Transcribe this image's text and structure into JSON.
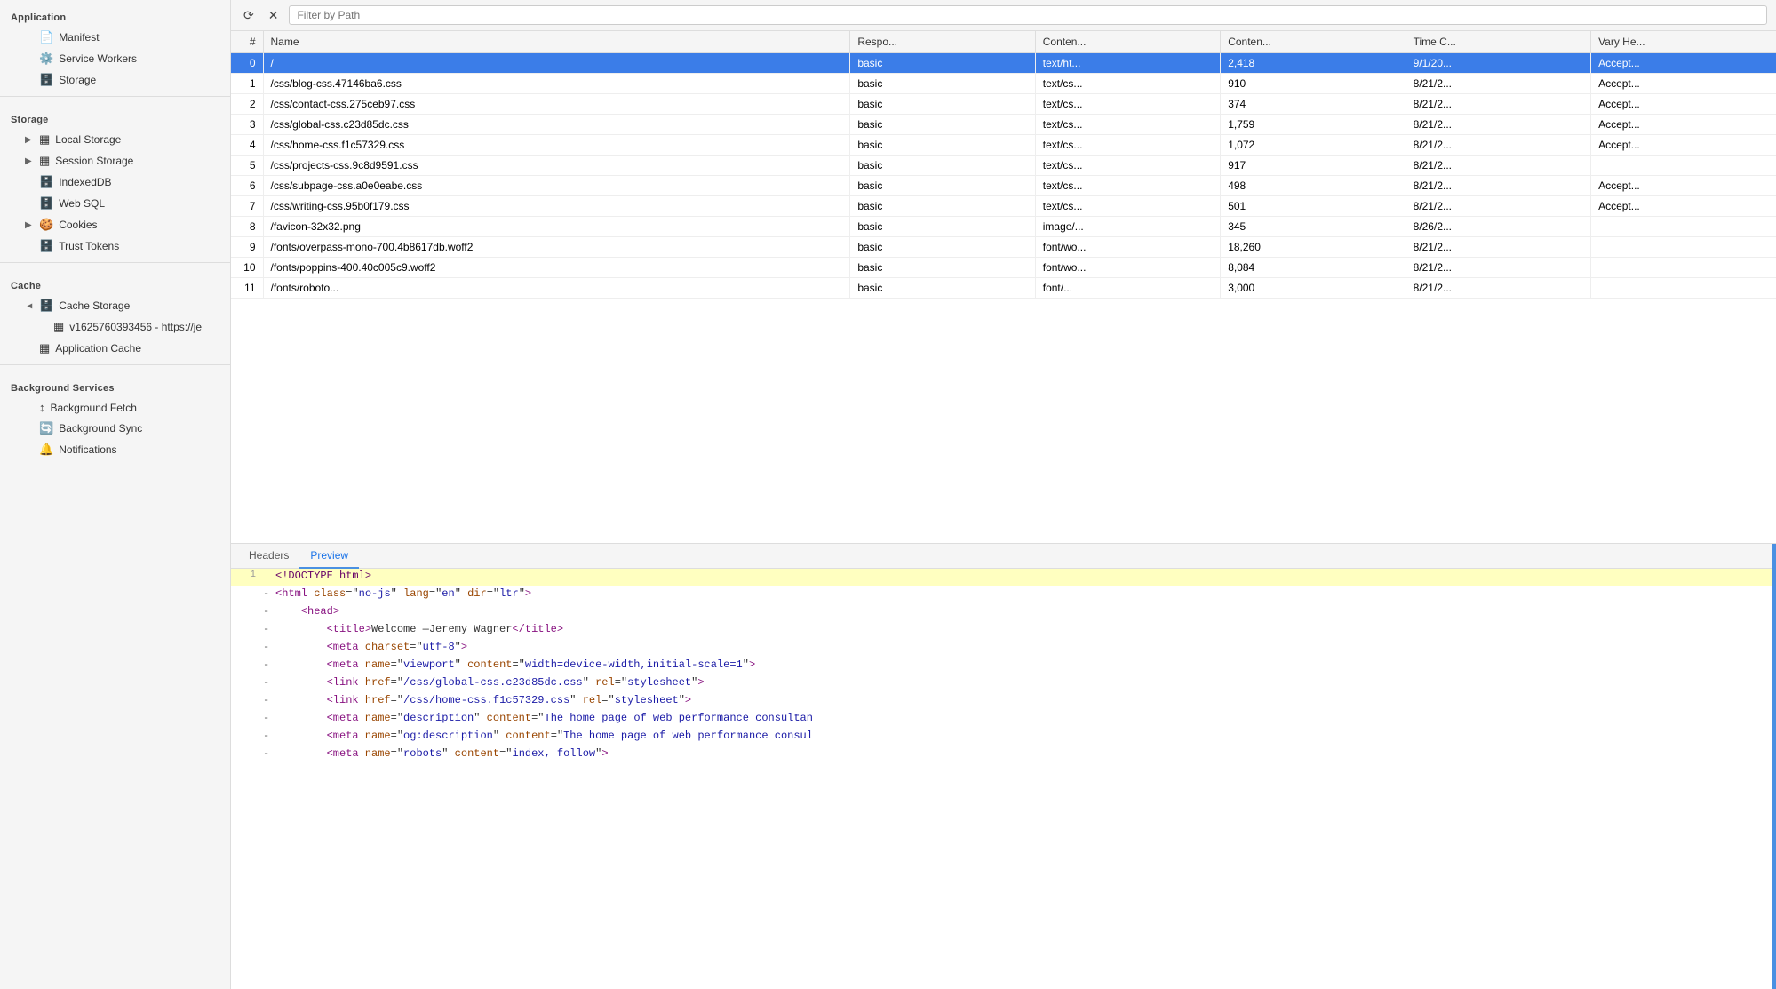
{
  "sidebar": {
    "sections": [
      {
        "label": "Application",
        "items": [
          {
            "id": "manifest",
            "label": "Manifest",
            "icon": "📄",
            "indent": 1,
            "arrow": false
          },
          {
            "id": "service-workers",
            "label": "Service Workers",
            "icon": "⚙️",
            "indent": 1,
            "arrow": false
          },
          {
            "id": "storage",
            "label": "Storage",
            "icon": "🗄️",
            "indent": 1,
            "arrow": false
          }
        ]
      },
      {
        "label": "Storage",
        "items": [
          {
            "id": "local-storage",
            "label": "Local Storage",
            "icon": "▦",
            "indent": 1,
            "arrow": true,
            "arrowOpen": false
          },
          {
            "id": "session-storage",
            "label": "Session Storage",
            "icon": "▦",
            "indent": 1,
            "arrow": true,
            "arrowOpen": false
          },
          {
            "id": "indexeddb",
            "label": "IndexedDB",
            "icon": "🗄️",
            "indent": 1,
            "arrow": false
          },
          {
            "id": "web-sql",
            "label": "Web SQL",
            "icon": "🗄️",
            "indent": 1,
            "arrow": false
          },
          {
            "id": "cookies",
            "label": "Cookies",
            "icon": "🍪",
            "indent": 1,
            "arrow": true,
            "arrowOpen": false
          },
          {
            "id": "trust-tokens",
            "label": "Trust Tokens",
            "icon": "🗄️",
            "indent": 1,
            "arrow": false
          }
        ]
      },
      {
        "label": "Cache",
        "items": [
          {
            "id": "cache-storage",
            "label": "Cache Storage",
            "icon": "🗄️",
            "indent": 1,
            "arrow": true,
            "arrowOpen": true
          },
          {
            "id": "cache-entry",
            "label": "v1625760393456 - https://je",
            "icon": "▦",
            "indent": 2,
            "arrow": false
          },
          {
            "id": "app-cache",
            "label": "Application Cache",
            "icon": "▦",
            "indent": 1,
            "arrow": false
          }
        ]
      },
      {
        "label": "Background Services",
        "items": [
          {
            "id": "bg-fetch",
            "label": "Background Fetch",
            "icon": "↕",
            "indent": 1,
            "arrow": false
          },
          {
            "id": "bg-sync",
            "label": "Background Sync",
            "icon": "🔄",
            "indent": 1,
            "arrow": false
          },
          {
            "id": "notifications",
            "label": "Notifications",
            "icon": "🔔",
            "indent": 1,
            "arrow": false
          }
        ]
      }
    ]
  },
  "toolbar": {
    "refresh_title": "Refresh",
    "clear_title": "Clear",
    "filter_placeholder": "Filter by Path"
  },
  "table": {
    "columns": [
      "#",
      "Name",
      "Respo...",
      "Conten...",
      "Conten...",
      "Time C...",
      "Vary He..."
    ],
    "rows": [
      {
        "num": "0",
        "name": "/",
        "resp": "basic",
        "ctype": "text/ht...",
        "clen": "2,418",
        "time": "9/1/20...",
        "vary": "Accept...",
        "selected": true
      },
      {
        "num": "1",
        "name": "/css/blog-css.47146ba6.css",
        "resp": "basic",
        "ctype": "text/cs...",
        "clen": "910",
        "time": "8/21/2...",
        "vary": "Accept...",
        "selected": false
      },
      {
        "num": "2",
        "name": "/css/contact-css.275ceb97.css",
        "resp": "basic",
        "ctype": "text/cs...",
        "clen": "374",
        "time": "8/21/2...",
        "vary": "Accept...",
        "selected": false
      },
      {
        "num": "3",
        "name": "/css/global-css.c23d85dc.css",
        "resp": "basic",
        "ctype": "text/cs...",
        "clen": "1,759",
        "time": "8/21/2...",
        "vary": "Accept...",
        "selected": false
      },
      {
        "num": "4",
        "name": "/css/home-css.f1c57329.css",
        "resp": "basic",
        "ctype": "text/cs...",
        "clen": "1,072",
        "time": "8/21/2...",
        "vary": "Accept...",
        "selected": false
      },
      {
        "num": "5",
        "name": "/css/projects-css.9c8d9591.css",
        "resp": "basic",
        "ctype": "text/cs...",
        "clen": "917",
        "time": "8/21/2...",
        "vary": "",
        "selected": false
      },
      {
        "num": "6",
        "name": "/css/subpage-css.a0e0eabe.css",
        "resp": "basic",
        "ctype": "text/cs...",
        "clen": "498",
        "time": "8/21/2...",
        "vary": "Accept...",
        "selected": false
      },
      {
        "num": "7",
        "name": "/css/writing-css.95b0f179.css",
        "resp": "basic",
        "ctype": "text/cs...",
        "clen": "501",
        "time": "8/21/2...",
        "vary": "Accept...",
        "selected": false
      },
      {
        "num": "8",
        "name": "/favicon-32x32.png",
        "resp": "basic",
        "ctype": "image/...",
        "clen": "345",
        "time": "8/26/2...",
        "vary": "",
        "selected": false
      },
      {
        "num": "9",
        "name": "/fonts/overpass-mono-700.4b8617db.woff2",
        "resp": "basic",
        "ctype": "font/wo...",
        "clen": "18,260",
        "time": "8/21/2...",
        "vary": "",
        "selected": false
      },
      {
        "num": "10",
        "name": "/fonts/poppins-400.40c005c9.woff2",
        "resp": "basic",
        "ctype": "font/wo...",
        "clen": "8,084",
        "time": "8/21/2...",
        "vary": "",
        "selected": false
      },
      {
        "num": "11",
        "name": "/fonts/roboto...",
        "resp": "basic",
        "ctype": "font/...",
        "clen": "3,000",
        "time": "8/21/2...",
        "vary": "",
        "selected": false
      }
    ]
  },
  "detail": {
    "tabs": [
      {
        "id": "headers",
        "label": "Headers",
        "active": false
      },
      {
        "id": "preview",
        "label": "Preview",
        "active": true
      }
    ],
    "code_lines": [
      {
        "num": "1",
        "marker": " ",
        "content": "<!DOCTYPE html>",
        "highlighted": true,
        "parts": [
          {
            "cls": "c-doctype",
            "text": "<!DOCTYPE html>"
          }
        ]
      },
      {
        "num": "",
        "marker": "-",
        "content": "<html class=\"no-js\" lang=\"en\" dir=\"ltr\">",
        "highlighted": false,
        "parts": [
          {
            "cls": "c-tag",
            "text": "<html"
          },
          {
            "cls": "c-text",
            "text": " "
          },
          {
            "cls": "c-attr",
            "text": "class"
          },
          {
            "cls": "c-text",
            "text": "=\""
          },
          {
            "cls": "c-val",
            "text": "no-js"
          },
          {
            "cls": "c-text",
            "text": "\" "
          },
          {
            "cls": "c-attr",
            "text": "lang"
          },
          {
            "cls": "c-text",
            "text": "=\""
          },
          {
            "cls": "c-val",
            "text": "en"
          },
          {
            "cls": "c-text",
            "text": "\" "
          },
          {
            "cls": "c-attr",
            "text": "dir"
          },
          {
            "cls": "c-text",
            "text": "=\""
          },
          {
            "cls": "c-val",
            "text": "ltr"
          },
          {
            "cls": "c-text",
            "text": "\""
          },
          {
            "cls": "c-tag",
            "text": ">"
          }
        ]
      },
      {
        "num": "",
        "marker": "-",
        "content": "    <head>",
        "highlighted": false,
        "parts": [
          {
            "cls": "c-text",
            "text": "    "
          },
          {
            "cls": "c-tag",
            "text": "<head>"
          }
        ]
      },
      {
        "num": "",
        "marker": "-",
        "content": "        <title>Welcome &mdash;Jeremy Wagner</title>",
        "highlighted": false,
        "parts": [
          {
            "cls": "c-text",
            "text": "        "
          },
          {
            "cls": "c-tag",
            "text": "<title>"
          },
          {
            "cls": "c-text",
            "text": "Welcome —Jeremy Wagner"
          },
          {
            "cls": "c-tag",
            "text": "</title>"
          }
        ]
      },
      {
        "num": "",
        "marker": "-",
        "content": "        <meta charset=\"utf-8\">",
        "highlighted": false,
        "parts": [
          {
            "cls": "c-text",
            "text": "        "
          },
          {
            "cls": "c-tag",
            "text": "<meta"
          },
          {
            "cls": "c-text",
            "text": " "
          },
          {
            "cls": "c-attr",
            "text": "charset"
          },
          {
            "cls": "c-text",
            "text": "=\""
          },
          {
            "cls": "c-val",
            "text": "utf-8"
          },
          {
            "cls": "c-text",
            "text": "\""
          },
          {
            "cls": "c-tag",
            "text": ">"
          }
        ]
      },
      {
        "num": "",
        "marker": "-",
        "content": "        <meta name=\"viewport\" content=\"width=device-width,initial-scale=1\">",
        "highlighted": false,
        "parts": [
          {
            "cls": "c-text",
            "text": "        "
          },
          {
            "cls": "c-tag",
            "text": "<meta"
          },
          {
            "cls": "c-text",
            "text": " "
          },
          {
            "cls": "c-attr",
            "text": "name"
          },
          {
            "cls": "c-text",
            "text": "=\""
          },
          {
            "cls": "c-val",
            "text": "viewport"
          },
          {
            "cls": "c-text",
            "text": "\" "
          },
          {
            "cls": "c-attr",
            "text": "content"
          },
          {
            "cls": "c-text",
            "text": "=\""
          },
          {
            "cls": "c-val",
            "text": "width=device-width,initial-scale=1"
          },
          {
            "cls": "c-text",
            "text": "\""
          },
          {
            "cls": "c-tag",
            "text": ">"
          }
        ]
      },
      {
        "num": "",
        "marker": "-",
        "content": "        <link href=\"/css/global-css.c23d85dc.css\" rel=\"stylesheet\">",
        "highlighted": false,
        "parts": [
          {
            "cls": "c-text",
            "text": "        "
          },
          {
            "cls": "c-tag",
            "text": "<link"
          },
          {
            "cls": "c-text",
            "text": " "
          },
          {
            "cls": "c-attr",
            "text": "href"
          },
          {
            "cls": "c-text",
            "text": "=\""
          },
          {
            "cls": "c-val",
            "text": "/css/global-css.c23d85dc.css"
          },
          {
            "cls": "c-text",
            "text": "\" "
          },
          {
            "cls": "c-attr",
            "text": "rel"
          },
          {
            "cls": "c-text",
            "text": "=\""
          },
          {
            "cls": "c-val",
            "text": "stylesheet"
          },
          {
            "cls": "c-text",
            "text": "\""
          },
          {
            "cls": "c-tag",
            "text": ">"
          }
        ]
      },
      {
        "num": "",
        "marker": "-",
        "content": "        <link href=\"/css/home-css.f1c57329.css\" rel=\"stylesheet\">",
        "highlighted": false,
        "parts": [
          {
            "cls": "c-text",
            "text": "        "
          },
          {
            "cls": "c-tag",
            "text": "<link"
          },
          {
            "cls": "c-text",
            "text": " "
          },
          {
            "cls": "c-attr",
            "text": "href"
          },
          {
            "cls": "c-text",
            "text": "=\""
          },
          {
            "cls": "c-val",
            "text": "/css/home-css.f1c57329.css"
          },
          {
            "cls": "c-text",
            "text": "\" "
          },
          {
            "cls": "c-attr",
            "text": "rel"
          },
          {
            "cls": "c-text",
            "text": "=\""
          },
          {
            "cls": "c-val",
            "text": "stylesheet"
          },
          {
            "cls": "c-text",
            "text": "\""
          },
          {
            "cls": "c-tag",
            "text": ">"
          }
        ]
      },
      {
        "num": "",
        "marker": "-",
        "content": "        <meta name=\"description\" content=\"The home page of web performance consultan",
        "highlighted": false,
        "parts": [
          {
            "cls": "c-text",
            "text": "        "
          },
          {
            "cls": "c-tag",
            "text": "<meta"
          },
          {
            "cls": "c-text",
            "text": " "
          },
          {
            "cls": "c-attr",
            "text": "name"
          },
          {
            "cls": "c-text",
            "text": "=\""
          },
          {
            "cls": "c-val",
            "text": "description"
          },
          {
            "cls": "c-text",
            "text": "\" "
          },
          {
            "cls": "c-attr",
            "text": "content"
          },
          {
            "cls": "c-text",
            "text": "=\""
          },
          {
            "cls": "c-val",
            "text": "The home page of web performance consultan"
          }
        ]
      },
      {
        "num": "",
        "marker": "-",
        "content": "        <meta name=\"og:description\" content=\"The home page of web performance consul",
        "highlighted": false,
        "parts": [
          {
            "cls": "c-text",
            "text": "        "
          },
          {
            "cls": "c-tag",
            "text": "<meta"
          },
          {
            "cls": "c-text",
            "text": " "
          },
          {
            "cls": "c-attr",
            "text": "name"
          },
          {
            "cls": "c-text",
            "text": "=\""
          },
          {
            "cls": "c-val",
            "text": "og:description"
          },
          {
            "cls": "c-text",
            "text": "\" "
          },
          {
            "cls": "c-attr",
            "text": "content"
          },
          {
            "cls": "c-text",
            "text": "=\""
          },
          {
            "cls": "c-val",
            "text": "The home page of web performance consul"
          }
        ]
      },
      {
        "num": "",
        "marker": "-",
        "content": "        <meta name=\"robots\" content=\"index, follow\">",
        "highlighted": false,
        "parts": [
          {
            "cls": "c-text",
            "text": "        "
          },
          {
            "cls": "c-tag",
            "text": "<meta"
          },
          {
            "cls": "c-text",
            "text": " "
          },
          {
            "cls": "c-attr",
            "text": "name"
          },
          {
            "cls": "c-text",
            "text": "=\""
          },
          {
            "cls": "c-val",
            "text": "robots"
          },
          {
            "cls": "c-text",
            "text": "\" "
          },
          {
            "cls": "c-attr",
            "text": "content"
          },
          {
            "cls": "c-text",
            "text": "=\""
          },
          {
            "cls": "c-val",
            "text": "index, follow"
          },
          {
            "cls": "c-text",
            "text": "\""
          },
          {
            "cls": "c-tag",
            "text": ">"
          }
        ]
      }
    ]
  }
}
